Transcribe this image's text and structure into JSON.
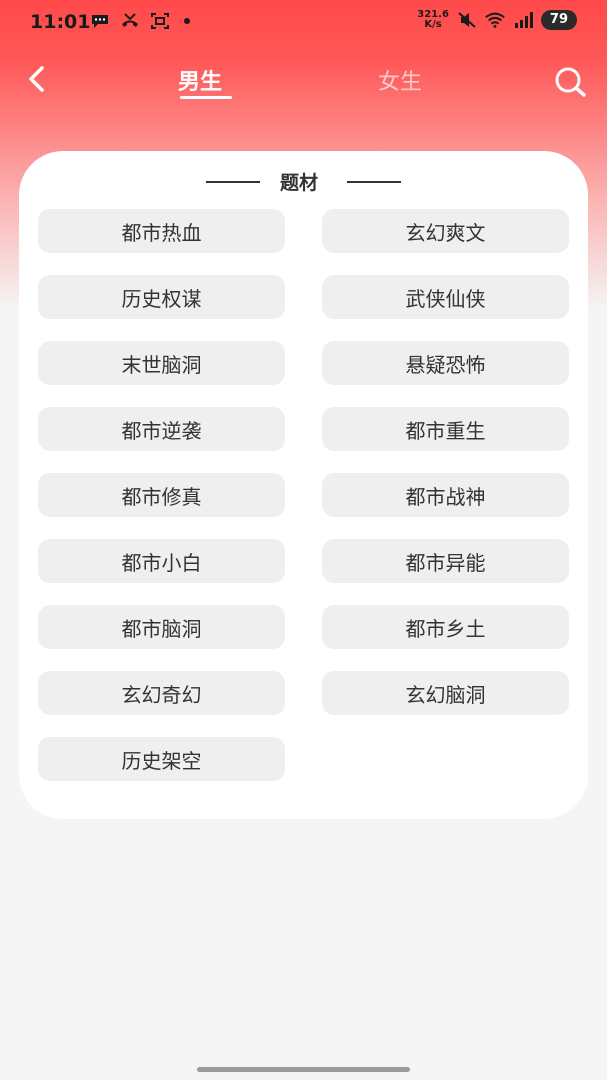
{
  "status_bar": {
    "time": "11:01",
    "net_speed_value": "321.6",
    "net_speed_unit": "K/s",
    "battery": "79",
    "icons": [
      "chat-bubble-icon",
      "missed-call-icon",
      "screen-capture-icon",
      "notification-dot-icon",
      "mute-icon",
      "wifi-icon",
      "signal-icon",
      "battery-icon"
    ]
  },
  "nav": {
    "back_icon": "chevron-left-icon",
    "tabs": [
      {
        "label": "男生",
        "active": true
      },
      {
        "label": "女生",
        "active": false
      }
    ],
    "search_icon": "search-icon"
  },
  "section": {
    "title": "题材",
    "items": [
      "都市热血",
      "玄幻爽文",
      "历史权谋",
      "武侠仙侠",
      "末世脑洞",
      "悬疑恐怖",
      "都市逆袭",
      "都市重生",
      "都市修真",
      "都市战神",
      "都市小白",
      "都市异能",
      "都市脑洞",
      "都市乡土",
      "玄幻奇幻",
      "玄幻脑洞",
      "历史架空"
    ]
  },
  "colors": {
    "header_red": "#ff4a4a",
    "chip_bg": "#efefef",
    "text_dark": "#333333"
  }
}
